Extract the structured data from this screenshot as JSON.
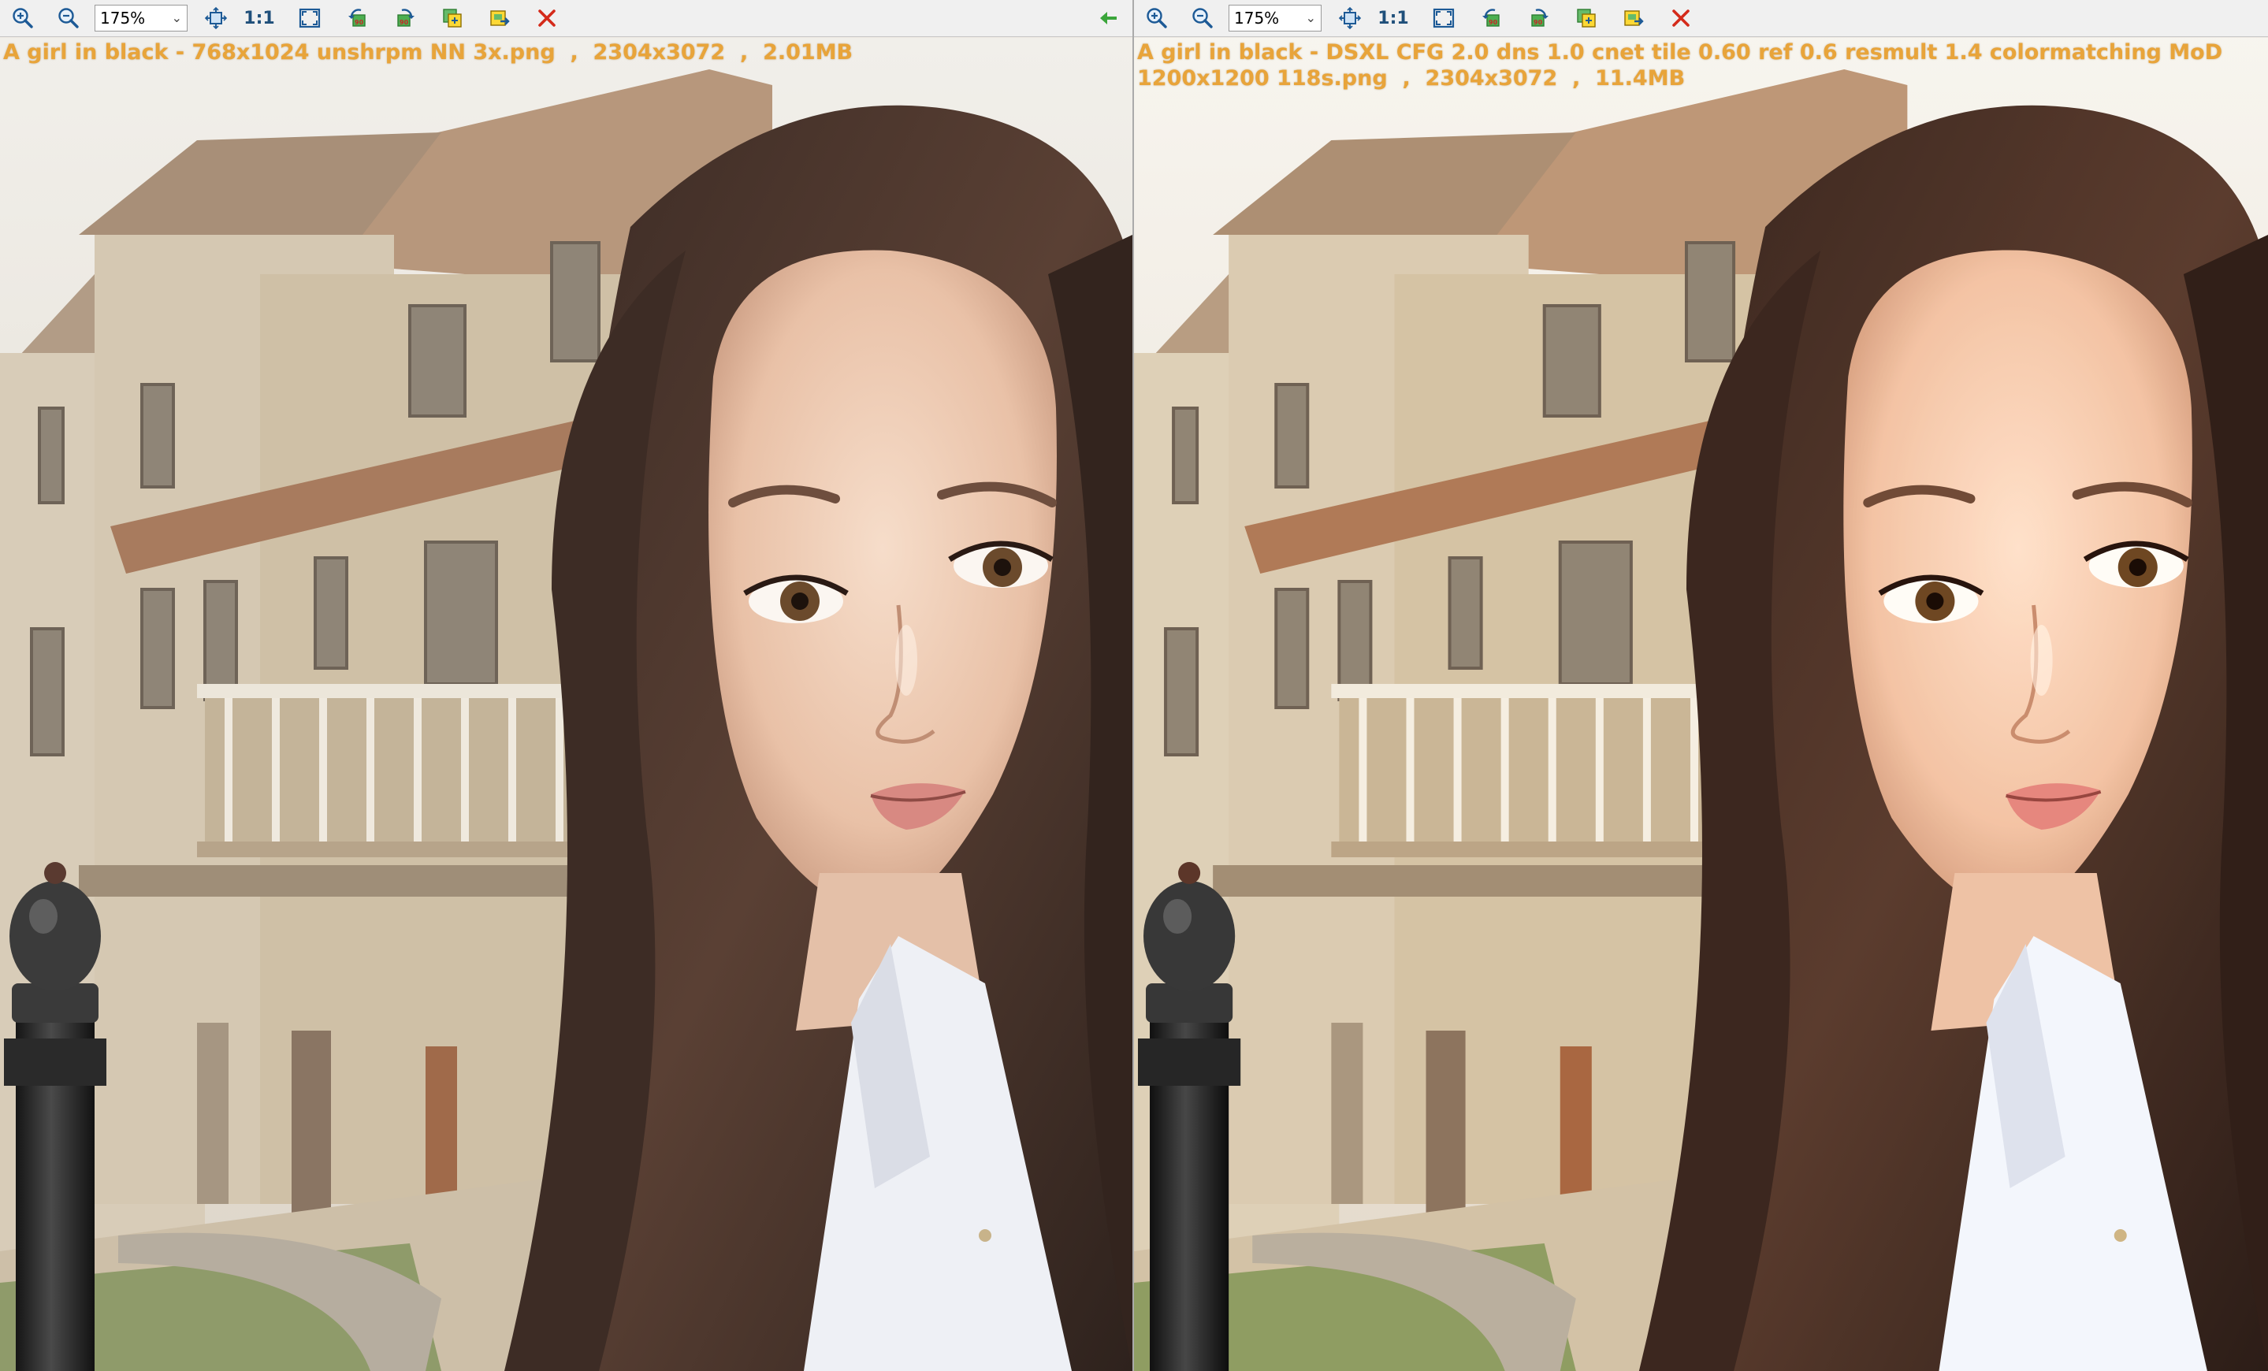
{
  "panes": [
    {
      "zoom": "175%",
      "one_to_one": "1:1",
      "caption": "A girl in black - 768x1024 unshrpm NN 3x.png  ,  2304x3072  ,  2.01MB"
    },
    {
      "zoom": "175%",
      "one_to_one": "1:1",
      "caption": "A girl in black - DSXL CFG 2.0 dns 1.0 cnet tile 0.60 ref 0.6 resmult 1.4 colormatching MoD 1200x1200 118s.png  ,  2304x3072  ,  11.4MB"
    }
  ],
  "icons": {
    "zoom_in": "zoom-in-icon",
    "zoom_out": "zoom-out-icon",
    "fit": "fit-window-icon",
    "fullscreen": "fullscreen-icon",
    "rotate_left": "rotate-left-icon",
    "rotate_right": "rotate-right-icon",
    "copy": "copy-image-icon",
    "save": "save-image-icon",
    "close": "close-icon",
    "back": "back-arrow-icon"
  },
  "colors": {
    "caption": "#e8a43a",
    "close": "#d42a1a",
    "back_arrow": "#3aa53a",
    "toolbar": "#f0f0f0"
  }
}
